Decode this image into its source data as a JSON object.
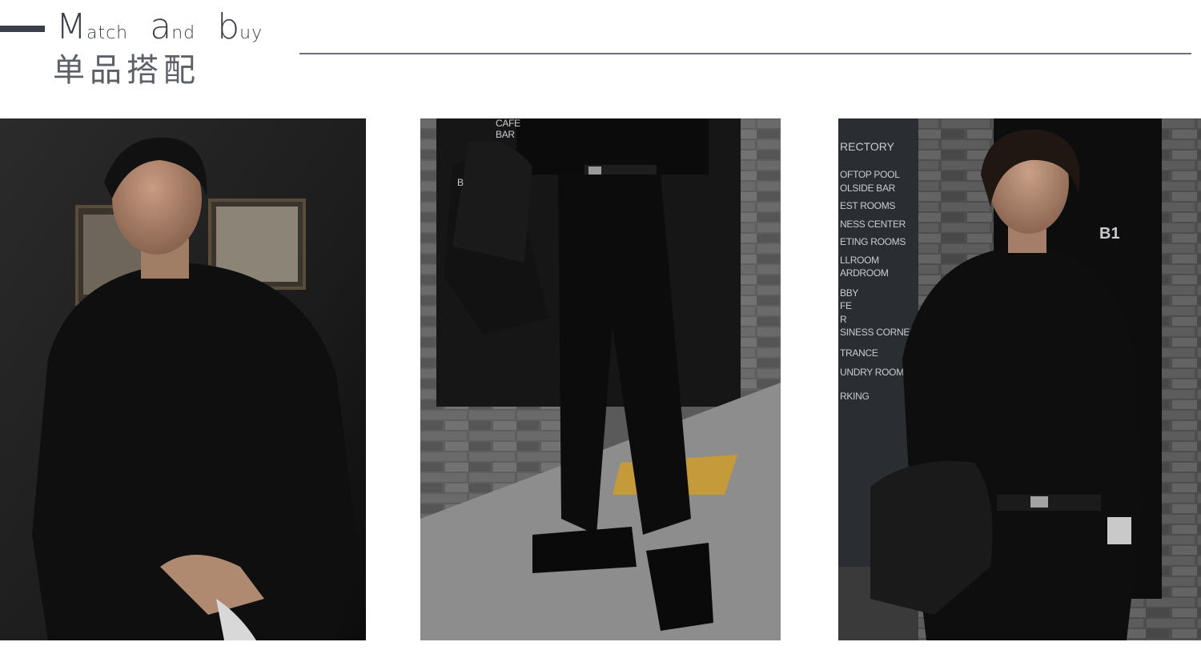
{
  "header": {
    "title_words": [
      {
        "cap": "M",
        "rest": "atch"
      },
      {
        "cap": "a",
        "rest": "nd"
      },
      {
        "cap": "b",
        "rest": "uy"
      }
    ],
    "subtitle": "单品搭配"
  },
  "photos": [
    {
      "subject": "model-seated-black-sweatshirt"
    },
    {
      "subject": "black-trousers-loafers-closeup"
    },
    {
      "subject": "model-black-turtleneck-profile"
    }
  ],
  "signage": {
    "directory_lines": [
      "RECTORY",
      "OFTOP POOL",
      "OLSIDE BAR",
      "EST ROOMS",
      "NESS CENTER",
      "ETING ROOMS",
      "LLROOM",
      "ARDROOM",
      "BBY",
      "FE",
      "R",
      "SINESS CORNER",
      "TRANCE",
      "UNDRY ROOM",
      "RKING"
    ],
    "photo2_lines": [
      "CAFE",
      "BAR",
      "B"
    ],
    "floor_label": "B1"
  },
  "colors": {
    "accent": "#3a3f4b",
    "rule": "#6b6f7a"
  }
}
